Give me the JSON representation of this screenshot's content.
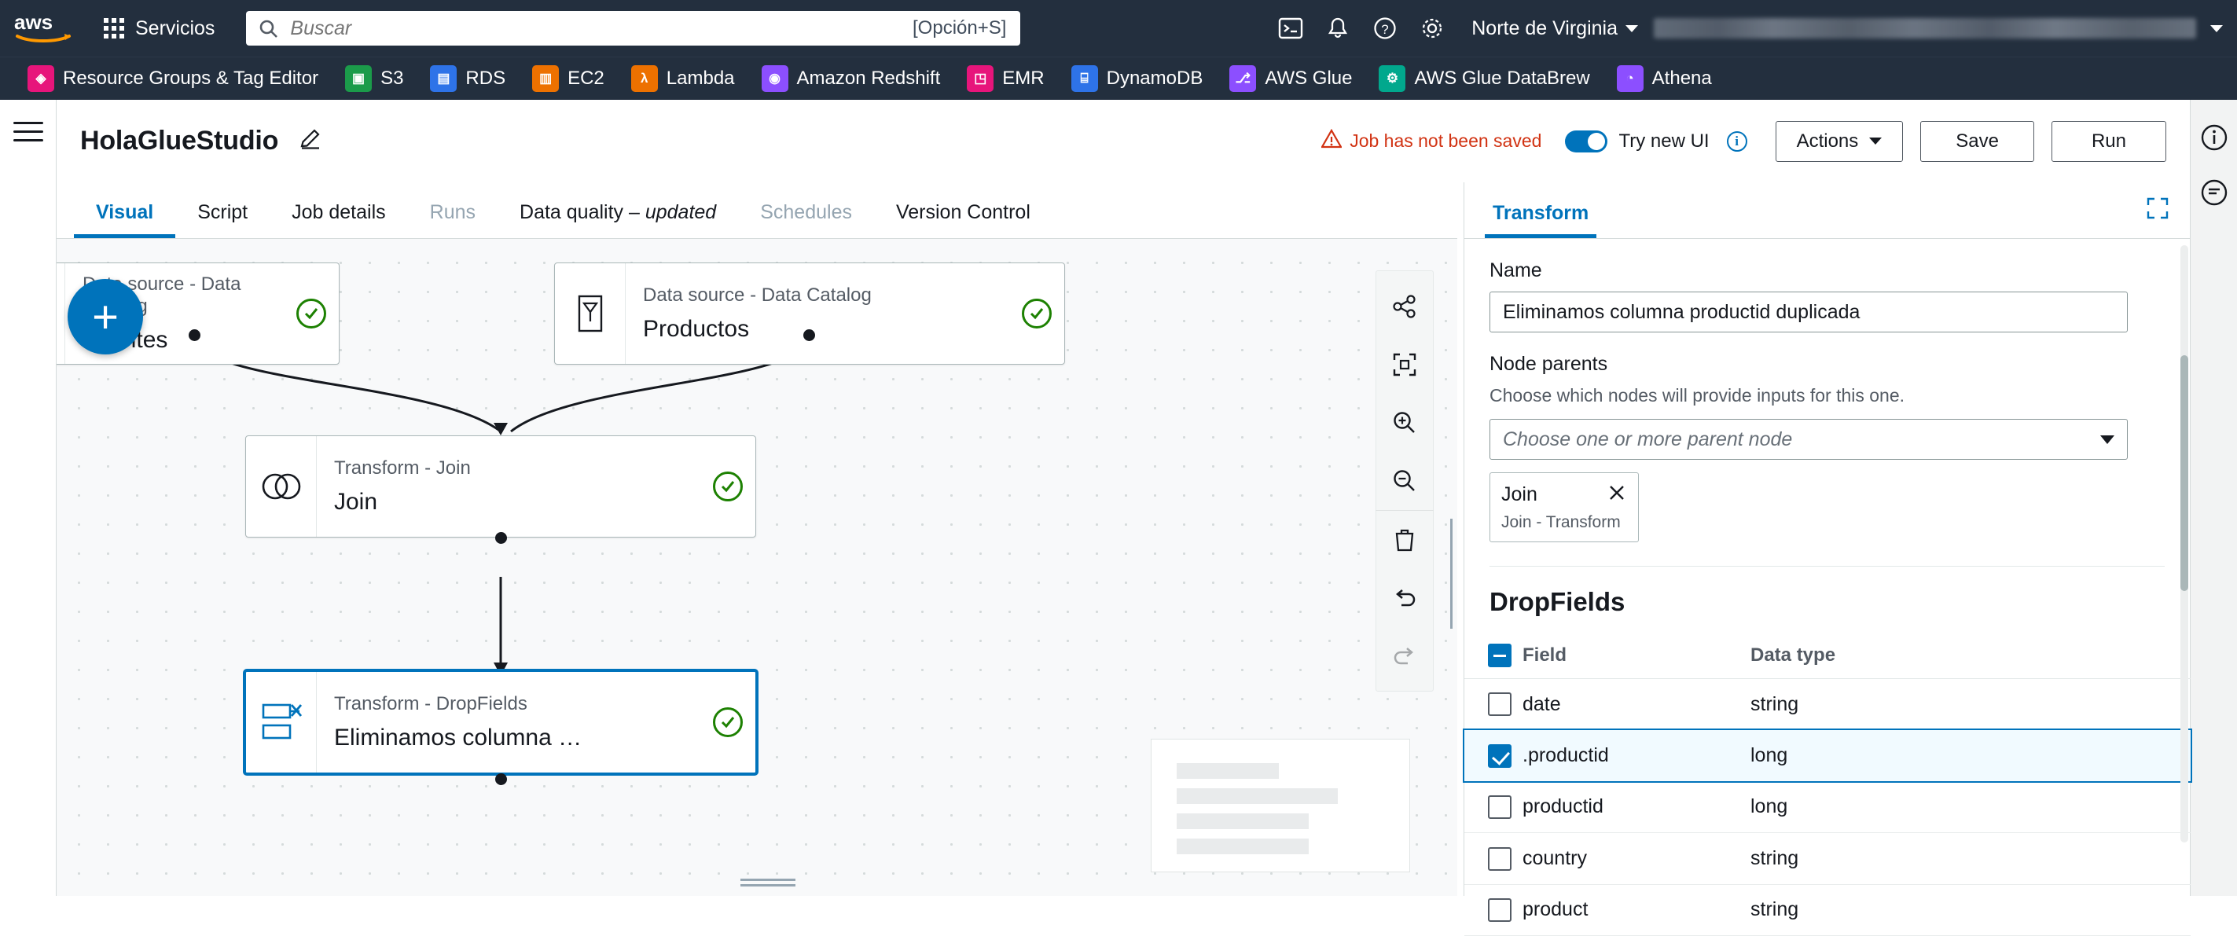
{
  "topbar": {
    "services_label": "Servicios",
    "search": {
      "placeholder": "Buscar",
      "hint": "[Opción+S]"
    },
    "region": "Norte de Virginia",
    "icons": [
      "cloudshell-icon",
      "bell-icon",
      "help-icon",
      "settings-icon"
    ]
  },
  "favorites": [
    {
      "label": "Resource Groups & Tag Editor",
      "color": "#e7157b",
      "glyph": "◈"
    },
    {
      "label": "S3",
      "color": "#1b9b4a",
      "glyph": "▣"
    },
    {
      "label": "RDS",
      "color": "#2e73e8",
      "glyph": "▤"
    },
    {
      "label": "EC2",
      "color": "#ed7100",
      "glyph": "▥"
    },
    {
      "label": "Lambda",
      "color": "#ed7100",
      "glyph": "λ"
    },
    {
      "label": "Amazon Redshift",
      "color": "#8c4fff",
      "glyph": "◉"
    },
    {
      "label": "EMR",
      "color": "#e7157b",
      "glyph": "◳"
    },
    {
      "label": "DynamoDB",
      "color": "#2e73e8",
      "glyph": "⌸"
    },
    {
      "label": "AWS Glue",
      "color": "#8c4fff",
      "glyph": "⎇"
    },
    {
      "label": "AWS Glue DataBrew",
      "color": "#01a88d",
      "glyph": "⚙"
    },
    {
      "label": "Athena",
      "color": "#8c4fff",
      "glyph": "◔"
    }
  ],
  "header": {
    "job_title": "HolaGlueStudio",
    "edit_icon": "pencil-icon",
    "not_saved": "Job has not been saved",
    "warning_icon": "warning-icon",
    "try_new_ui": "Try new UI",
    "actions_label": "Actions",
    "save_label": "Save",
    "run_label": "Run"
  },
  "tabs": [
    {
      "label": "Visual",
      "state": "active"
    },
    {
      "label": "Script",
      "state": "normal"
    },
    {
      "label": "Job details",
      "state": "normal"
    },
    {
      "label": "Runs",
      "state": "dim"
    },
    {
      "label": "Data quality – updated",
      "state": "normal"
    },
    {
      "label": "Schedules",
      "state": "dim"
    },
    {
      "label": "Version Control",
      "state": "normal"
    }
  ],
  "canvas": {
    "add_node_button": "+",
    "nodes": [
      {
        "sub": "Data source - Data Catalog",
        "name": "Clientes",
        "icon": "data-catalog-icon",
        "status": "ok"
      },
      {
        "sub": "Data source - Data Catalog",
        "name": "Productos",
        "icon": "data-catalog-icon",
        "status": "ok"
      },
      {
        "sub": "Transform - Join",
        "name": "Join",
        "icon": "join-icon",
        "status": "ok"
      },
      {
        "sub": "Transform - DropFields",
        "name": "Eliminamos columna …",
        "icon": "dropfields-icon",
        "status": "ok"
      }
    ],
    "tools": [
      "share-icon",
      "fit-to-screen-icon",
      "zoom-in-icon",
      "zoom-out-icon",
      "delete-icon",
      "undo-icon",
      "redo-icon"
    ]
  },
  "panel": {
    "tab_label": "Transform",
    "expand_icon": "expand-icon",
    "name_label": "Name",
    "name_value": "Eliminamos columna productid duplicada",
    "node_parents_label": "Node parents",
    "node_parents_desc": "Choose which nodes will provide inputs for this one.",
    "parents_placeholder": "Choose one or more parent node",
    "parent_chip": {
      "title": "Join",
      "subtitle": "Join - Transform",
      "remove_icon": "close-icon"
    },
    "section_title": "DropFields",
    "table": {
      "headers": [
        "",
        "Field",
        "Data type"
      ],
      "header_checkbox_state": "indeterminate",
      "rows": [
        {
          "checked": false,
          "field": "date",
          "type": "string",
          "selected": false
        },
        {
          "checked": true,
          "field": ".productid",
          "type": "long",
          "selected": true
        },
        {
          "checked": false,
          "field": "productid",
          "type": "long",
          "selected": false
        },
        {
          "checked": false,
          "field": "country",
          "type": "string",
          "selected": false
        },
        {
          "checked": false,
          "field": "product",
          "type": "string",
          "selected": false
        }
      ]
    }
  },
  "right_rail": {
    "icons": [
      "info-icon",
      "comment-icon"
    ]
  },
  "colors": {
    "accent": "#0073bb",
    "nav_bg": "#232f3e",
    "warning": "#d13212",
    "success": "#1d8102"
  }
}
